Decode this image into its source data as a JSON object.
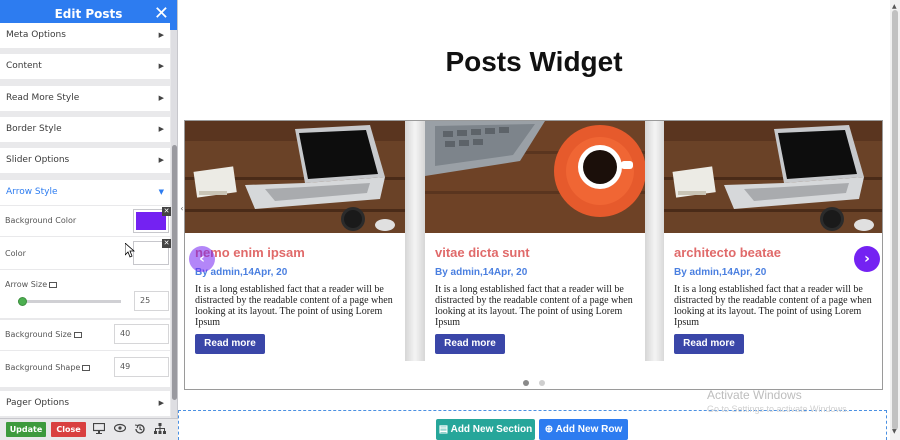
{
  "panel": {
    "title": "Edit Posts",
    "sections": [
      {
        "label": "Meta Options"
      },
      {
        "label": "Content"
      },
      {
        "label": "Read More Style"
      },
      {
        "label": "Border Style"
      },
      {
        "label": "Slider Options"
      },
      {
        "label": "Arrow Style"
      }
    ],
    "controls": {
      "bg_color_label": "Background Color",
      "bg_color_value": "#7422f2",
      "color_label": "Color",
      "arrow_size_label": "Arrow Size",
      "arrow_size_value": "25",
      "bg_size_label": "Background Size",
      "bg_size_value": "40",
      "bg_shape_label": "Background Shape",
      "bg_shape_value": "49"
    },
    "pager_label": "Pager Options",
    "update_label": "Update",
    "close_label": "Close"
  },
  "main": {
    "title": "Posts Widget",
    "posts": [
      {
        "title": "nemo enim ipsam",
        "meta": "By admin,14Apr, 20",
        "excerpt": "It is a long established fact that a reader will be distracted by the readable content of a page when looking at its layout. The point of using Lorem Ipsum",
        "read_more": "Read more",
        "image": "laptop-desk"
      },
      {
        "title": "vitae dicta sunt",
        "meta": "By admin,14Apr, 20",
        "excerpt": "It is a long established fact that a reader will be distracted by the readable content of a page when looking at its layout. The point of using Lorem Ipsum",
        "read_more": "Read more",
        "image": "coffee-cup"
      },
      {
        "title": "architecto beatae",
        "meta": "By admin,14Apr, 20",
        "excerpt": "It is a long established fact that a reader will be distracted by the readable content of a page when looking at its layout. The point of using Lorem Ipsum",
        "read_more": "Read more",
        "image": "laptop-desk"
      }
    ],
    "add_section_label": "Add New Section",
    "add_row_label": "Add New Row"
  },
  "overlay": {
    "activate_title": "Activate Windows",
    "activate_sub": "Go to Settings to activate Windows."
  },
  "colors": {
    "accent": "#2d7cf0",
    "arrow_bg": "#7422f2",
    "title": "#e06a6a",
    "meta": "#4a7fe0",
    "read_more_bg": "#3a46a8",
    "update_bg": "#3d9a3d",
    "close_bg": "#d94040",
    "add_section_bg": "#26a69a",
    "add_row_bg": "#2d7cf0"
  },
  "icons": [
    "close-icon",
    "chevron-right-icon",
    "chevron-down-icon",
    "monitor-icon",
    "eye-icon",
    "history-icon",
    "sitemap-icon",
    "document-icon",
    "plus-circle-icon"
  ]
}
